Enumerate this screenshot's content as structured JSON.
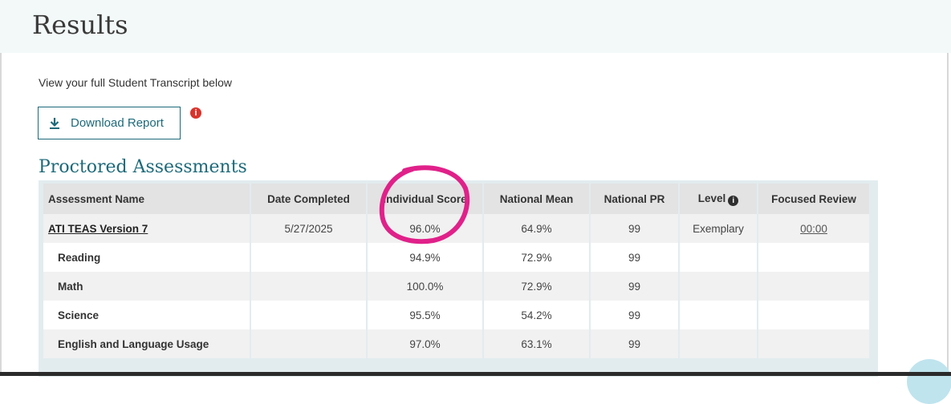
{
  "page": {
    "title": "Results",
    "intro": "View your full Student Transcript below"
  },
  "download": {
    "label": "Download Report",
    "icon": "download-icon"
  },
  "alert_icon": {
    "icon": "alert-info-icon",
    "glyph": "i",
    "color": "#d9332b"
  },
  "section": {
    "title": "Proctored Assessments"
  },
  "table": {
    "headers": [
      "Assessment Name",
      "Date Completed",
      "Individual Score",
      "National Mean",
      "National PR",
      "Level",
      "Focused Review"
    ],
    "level_info_glyph": "i",
    "main_row": {
      "name": "ATI TEAS Version 7",
      "date": "5/27/2025",
      "score": "96.0%",
      "mean": "64.9%",
      "pr": "99",
      "level": "Exemplary",
      "review": "00:00"
    },
    "sub_rows": [
      {
        "name": "Reading",
        "score": "94.9%",
        "mean": "72.9%",
        "pr": "99"
      },
      {
        "name": "Math",
        "score": "100.0%",
        "mean": "72.9%",
        "pr": "99"
      },
      {
        "name": "Science",
        "score": "95.5%",
        "mean": "54.2%",
        "pr": "99"
      },
      {
        "name": "English and Language Usage",
        "score": "97.0%",
        "mean": "63.1%",
        "pr": "99"
      }
    ]
  },
  "colors": {
    "accent": "#1d6a7a",
    "annotation_circle": "#e0218a",
    "header_bg": "#e3e3e3"
  }
}
